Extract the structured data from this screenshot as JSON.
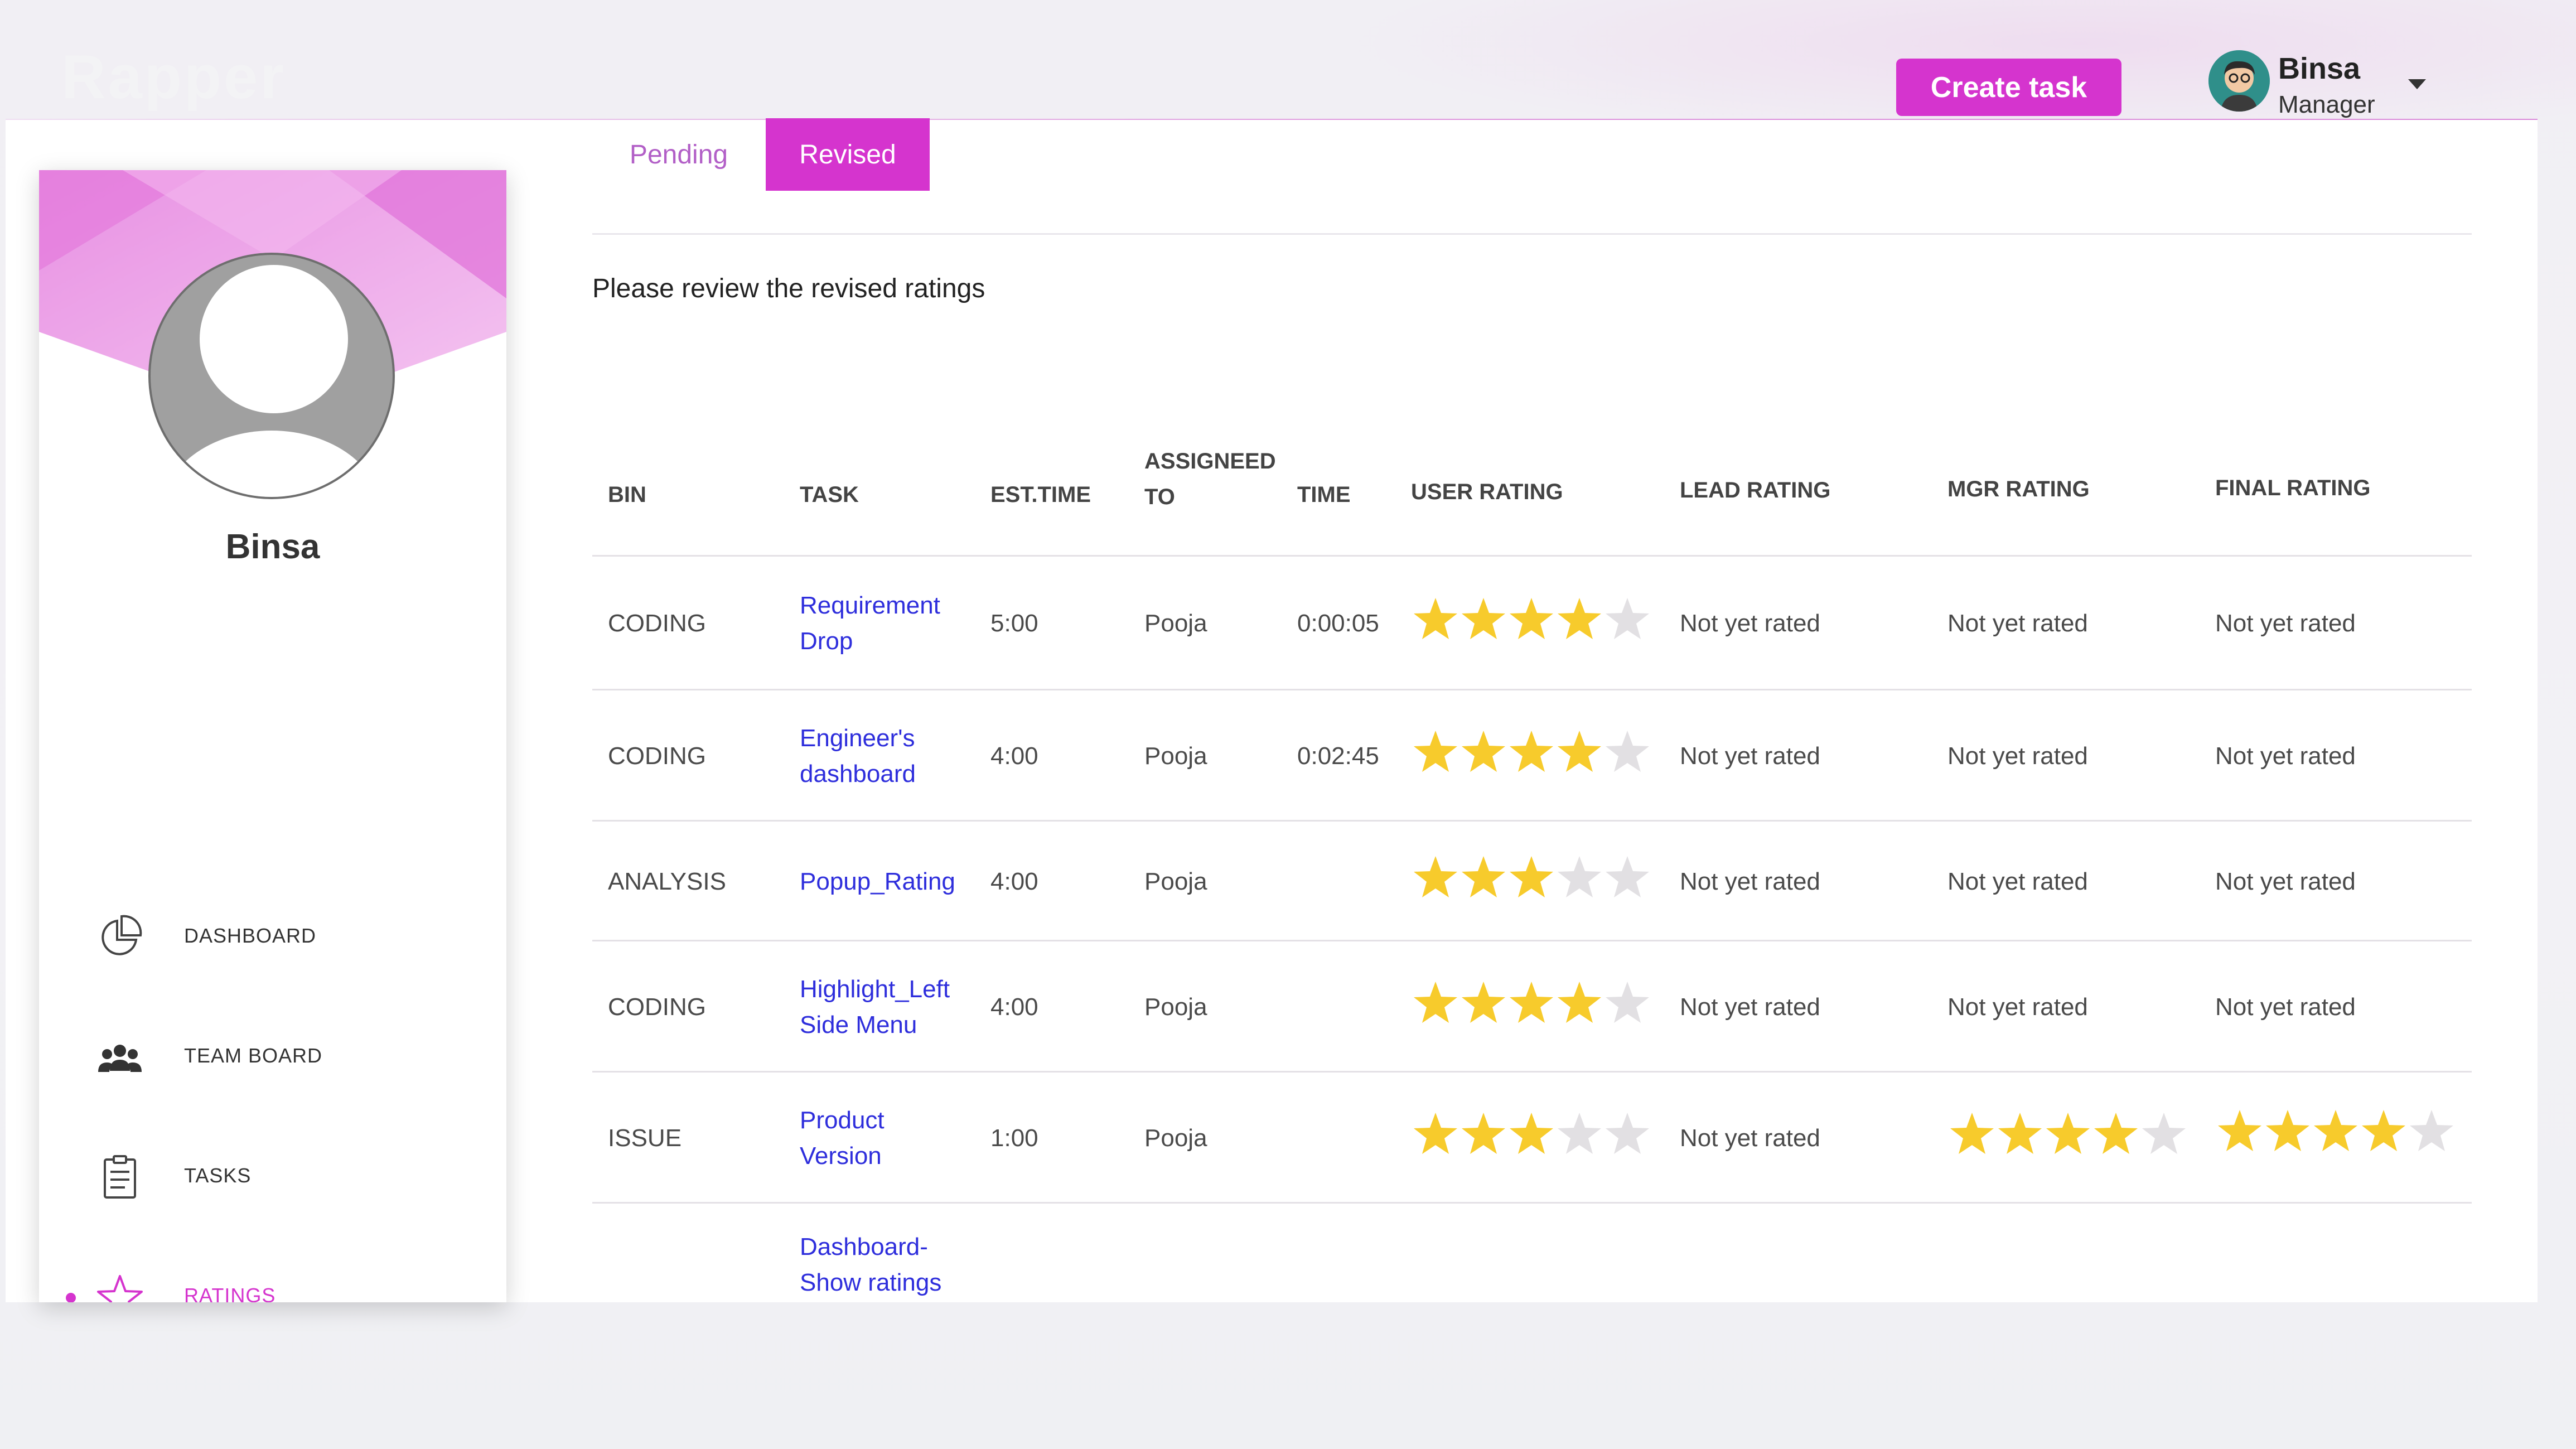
{
  "brand": "Rapper",
  "header": {
    "create_task_label": "Create task",
    "user_name": "Binsa",
    "user_role": "Manager"
  },
  "sidebar": {
    "profile_name": "Binsa",
    "items": [
      {
        "label": "DASHBOARD",
        "icon": "pie-chart-icon"
      },
      {
        "label": "TEAM BOARD",
        "icon": "team-icon"
      },
      {
        "label": "TASKS",
        "icon": "clipboard-icon"
      },
      {
        "label": "RATINGS",
        "icon": "star-icon",
        "active": true
      }
    ]
  },
  "tabs": [
    {
      "label": "Pending",
      "active": false
    },
    {
      "label": "Revised",
      "active": true
    }
  ],
  "subtitle": "Please review the revised ratings",
  "table": {
    "headers": {
      "bin": "BIN",
      "task": "TASK",
      "est_time": "EST.TIME",
      "assigned_1": "ASSIGNEED",
      "assigned_2": "TO",
      "time": "TIME",
      "user_rating": "USER RATING",
      "lead_rating": "LEAD RATING",
      "mgr_rating": "MGR RATING",
      "final_rating": "FINAL RATING"
    },
    "rows": [
      {
        "bin": "CODING",
        "task_1": "Requirement",
        "task_2": "Drop",
        "est_time": "5:00",
        "assigned": "Pooja",
        "time": "0:00:05",
        "user_rating": 4,
        "lead_rating": "Not yet rated",
        "mgr_rating": "Not yet rated",
        "final_rating": "Not yet rated"
      },
      {
        "bin": "CODING",
        "task_1": "Engineer's",
        "task_2": "dashboard",
        "est_time": "4:00",
        "assigned": "Pooja",
        "time": "0:02:45",
        "user_rating": 4,
        "lead_rating": "Not yet rated",
        "mgr_rating": "Not yet rated",
        "final_rating": "Not yet rated"
      },
      {
        "bin": "ANALYSIS",
        "task_1": "Popup_Rating",
        "task_2": "",
        "est_time": "4:00",
        "assigned": "Pooja",
        "time": "",
        "user_rating": 3,
        "lead_rating": "Not yet rated",
        "mgr_rating": "Not yet rated",
        "final_rating": "Not yet rated"
      },
      {
        "bin": "CODING",
        "task_1": "Highlight_Left",
        "task_2": "Side Menu",
        "est_time": "4:00",
        "assigned": "Pooja",
        "time": "",
        "user_rating": 4,
        "lead_rating": "Not yet rated",
        "mgr_rating": "Not yet rated",
        "final_rating": "Not yet rated"
      },
      {
        "bin": "ISSUE",
        "task_1": "Product",
        "task_2": "Version",
        "est_time": "1:00",
        "assigned": "Pooja",
        "time": "",
        "user_rating": 3,
        "lead_rating": "Not yet rated",
        "mgr_rating_stars": 4,
        "final_rating_stars": 4
      },
      {
        "bin": "",
        "task_1": "Dashboard-",
        "task_2": "Show ratings",
        "est_time": "",
        "assigned": "",
        "time": "",
        "user_rating": 0
      }
    ]
  },
  "colors": {
    "accent": "#d534ce",
    "star_filled": "#f7cb2c",
    "star_empty": "#e2e0e3",
    "link": "#2e2edc"
  }
}
